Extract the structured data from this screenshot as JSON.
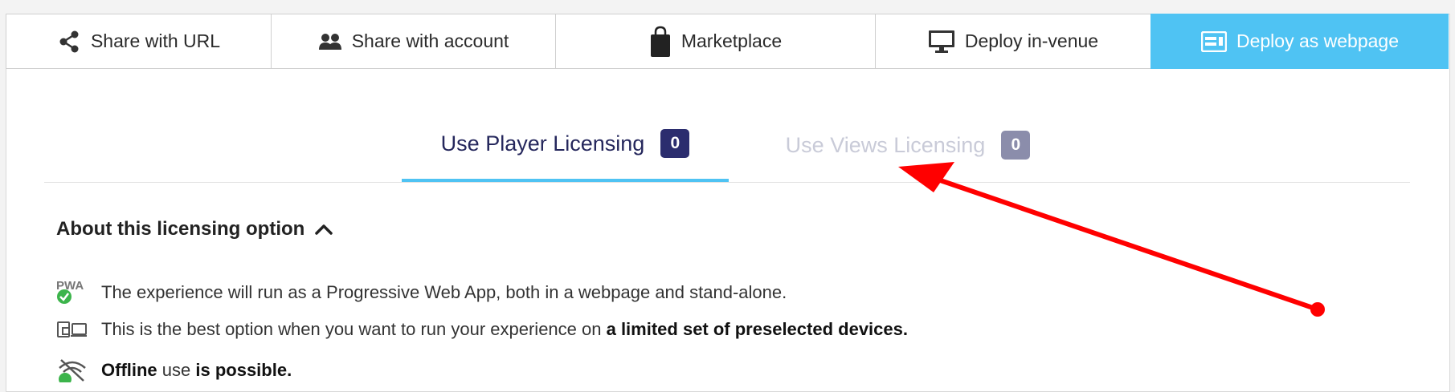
{
  "share_tabs": [
    {
      "label": "Share with URL",
      "icon": "share-icon"
    },
    {
      "label": "Share with account",
      "icon": "users-icon"
    },
    {
      "label": "Marketplace",
      "icon": "shopping-bag-icon"
    },
    {
      "label": "Deploy in-venue",
      "icon": "monitor-icon"
    },
    {
      "label": "Deploy as webpage",
      "icon": "webpage-icon",
      "active": true
    }
  ],
  "licensing_tabs": [
    {
      "label": "Use Player Licensing",
      "count": "0",
      "active": true
    },
    {
      "label": "Use Views Licensing",
      "count": "0",
      "active": false
    }
  ],
  "about": {
    "title": "About this licensing option",
    "icon": "chevron-up-icon"
  },
  "info": {
    "pwa": {
      "icon": "pwa-icon",
      "text": "The experience will run as a Progressive Web App, both in a webpage and stand-alone."
    },
    "devices": {
      "icon": "devices-icon",
      "text_prefix": "This is the best option when you want to run your experience on ",
      "text_bold": "a limited set of preselected devices."
    },
    "offline": {
      "icon": "wifi-off-icon",
      "bold1": "Offline",
      "middle": " use ",
      "bold2": "is possible."
    }
  },
  "colors": {
    "accent": "#4fc3f3",
    "navy": "#2b2d6e",
    "annotation_arrow": "#ff0000"
  }
}
